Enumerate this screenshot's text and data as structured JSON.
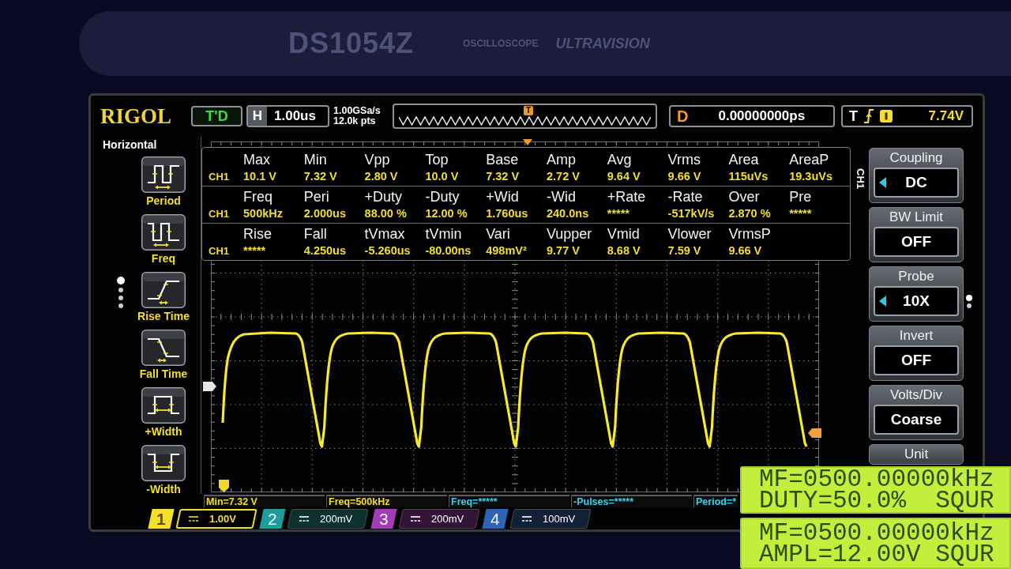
{
  "bezel": {
    "model": "DS1054Z",
    "labels": [
      "OSCILLOSCOPE",
      "ULTRAVISION"
    ]
  },
  "top_bar": {
    "logo": "RIGOL",
    "trigger_status": "T'D",
    "timebase": {
      "label": "H",
      "value": "1.00us"
    },
    "sample_rate": "1.00GSa/s",
    "memory_depth": "12.0k pts",
    "memory_marker": "T",
    "delay": {
      "label": "D",
      "value": "0.00000000ps"
    },
    "trigger": {
      "label": "T",
      "value": "7.74V"
    }
  },
  "sidebar": {
    "title": "Horizontal",
    "page_dots": [
      {
        "selected": true
      },
      {
        "selected": false
      },
      {
        "selected": false
      },
      {
        "selected": false
      }
    ],
    "items": [
      {
        "kind": "period",
        "label": "Period"
      },
      {
        "kind": "freq",
        "label": "Freq"
      },
      {
        "kind": "rise_time",
        "label": "Rise Time"
      },
      {
        "kind": "fall_time",
        "label": "Fall Time"
      },
      {
        "kind": "pos_width",
        "label": "+Width"
      },
      {
        "kind": "neg_width",
        "label": "-Width"
      }
    ]
  },
  "measurements": {
    "rows": [
      {
        "source": "CH1",
        "names": [
          "Max",
          "Min",
          "Vpp",
          "Top",
          "Base",
          "Amp",
          "Avg",
          "Vrms",
          "Area",
          "AreaP"
        ],
        "values": [
          "10.1 V",
          "7.32 V",
          "2.80 V",
          "10.0 V",
          "7.32 V",
          "2.72 V",
          "9.64 V",
          "9.66 V",
          "115uVs",
          "19.3uVs"
        ]
      },
      {
        "source": "CH1",
        "names": [
          "Freq",
          "Peri",
          "+Duty",
          "-Duty",
          "+Wid",
          "-Wid",
          "+Rate",
          "-Rate",
          "Over",
          "Pre"
        ],
        "values": [
          "500kHz",
          "2.000us",
          "88.00 %",
          "12.00 %",
          "1.760us",
          "240.0ns",
          "*****",
          "-517kV/s",
          "2.870 %",
          "*****"
        ]
      },
      {
        "source": "CH1",
        "names": [
          "Rise",
          "Fall",
          "tVmax",
          "tVmin",
          "Vari",
          "Vupper",
          "Vmid",
          "Vlower",
          "VrmsP"
        ],
        "values": [
          "*****",
          "4.250us",
          "-5.260us",
          "-80.00ns",
          "498mV²",
          "9.77 V",
          "8.68 V",
          "7.59 V",
          "9.66 V"
        ]
      }
    ]
  },
  "menu": {
    "channel": "CH1",
    "items": [
      {
        "title": "Coupling",
        "value": "DC",
        "adjustable": true
      },
      {
        "title": "BW Limit",
        "value": "OFF",
        "adjustable": false
      },
      {
        "title": "Probe",
        "value": "10X",
        "adjustable": true
      },
      {
        "title": "Invert",
        "value": "OFF",
        "adjustable": false
      },
      {
        "title": "Volts/Div",
        "value": "Coarse",
        "adjustable": false
      },
      {
        "title": "Unit"
      }
    ],
    "page_dots": [
      {
        "selected": true
      },
      {
        "selected": false
      }
    ]
  },
  "readouts": [
    {
      "text": "Min=7.32 V",
      "color": "#f3df2c"
    },
    {
      "text": "Freq=500kHz",
      "color": "#f3df2c"
    },
    {
      "text": "Freq=*****",
      "color": "#35d4ec"
    },
    {
      "text": "-Pulses=*****",
      "color": "#35d4ec"
    },
    {
      "text": "Period=*",
      "color": "#35d4ec"
    }
  ],
  "channels": [
    {
      "number": "1",
      "scale": "1.00V",
      "selected": true,
      "color": "#f3df2c"
    },
    {
      "number": "2",
      "scale": "200mV",
      "selected": false,
      "color": "#1f9c9c"
    },
    {
      "number": "3",
      "scale": "200mV",
      "selected": false,
      "color": "#a23cb4"
    },
    {
      "number": "4",
      "scale": "100mV",
      "selected": false,
      "color": "#2d64b4"
    }
  ],
  "lcd_displays": [
    {
      "lines": [
        "MF=0500.00000kHz",
        "DUTY=50.0%  SQUR"
      ]
    },
    {
      "lines": [
        "MF=0500.00000kHz",
        "AMPL=12.00V SQUR"
      ]
    }
  ]
}
